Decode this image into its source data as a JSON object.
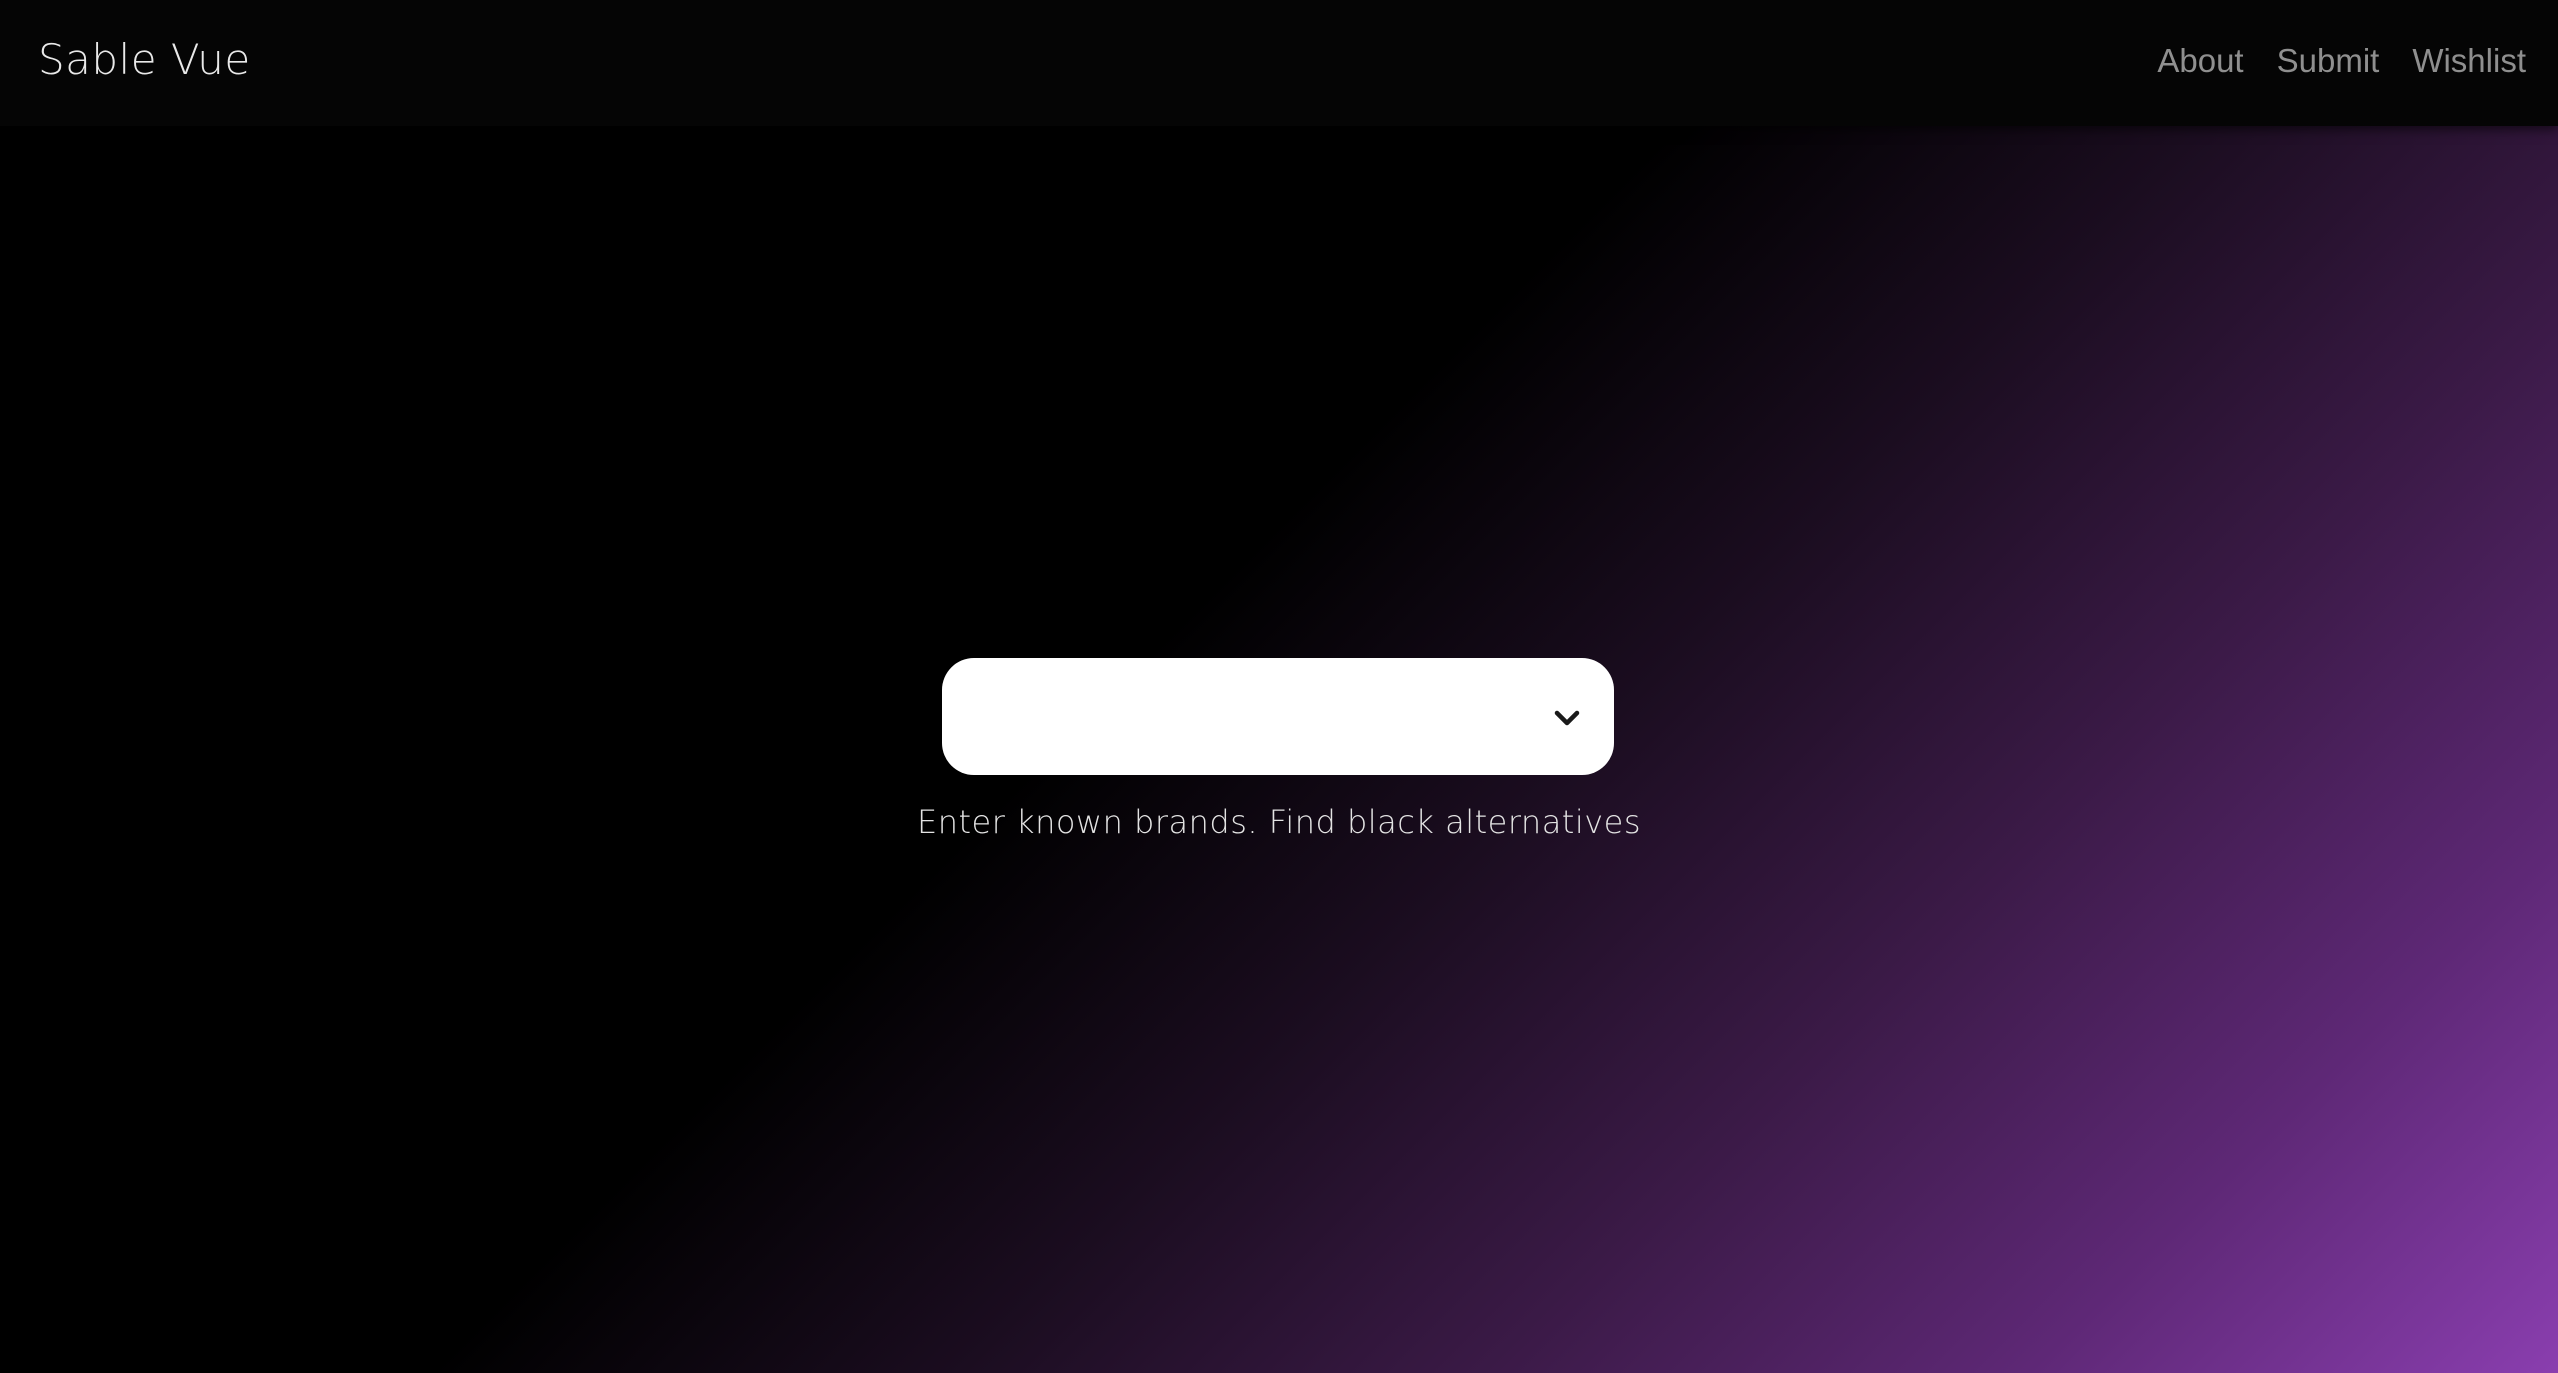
{
  "header": {
    "brand": "Sable Vue",
    "nav": [
      {
        "label": "About"
      },
      {
        "label": "Submit"
      },
      {
        "label": "Wishlist"
      }
    ]
  },
  "search": {
    "selected_value": "",
    "icon": "chevron-down-icon"
  },
  "hero": {
    "tagline": "Enter known brands. Find black alternatives"
  },
  "colors": {
    "header_bg": "#050505",
    "gradient_start": "#000000",
    "gradient_end": "#8a3eaf",
    "nav_text": "#8f8f8f",
    "select_bg": "#ffffff"
  }
}
